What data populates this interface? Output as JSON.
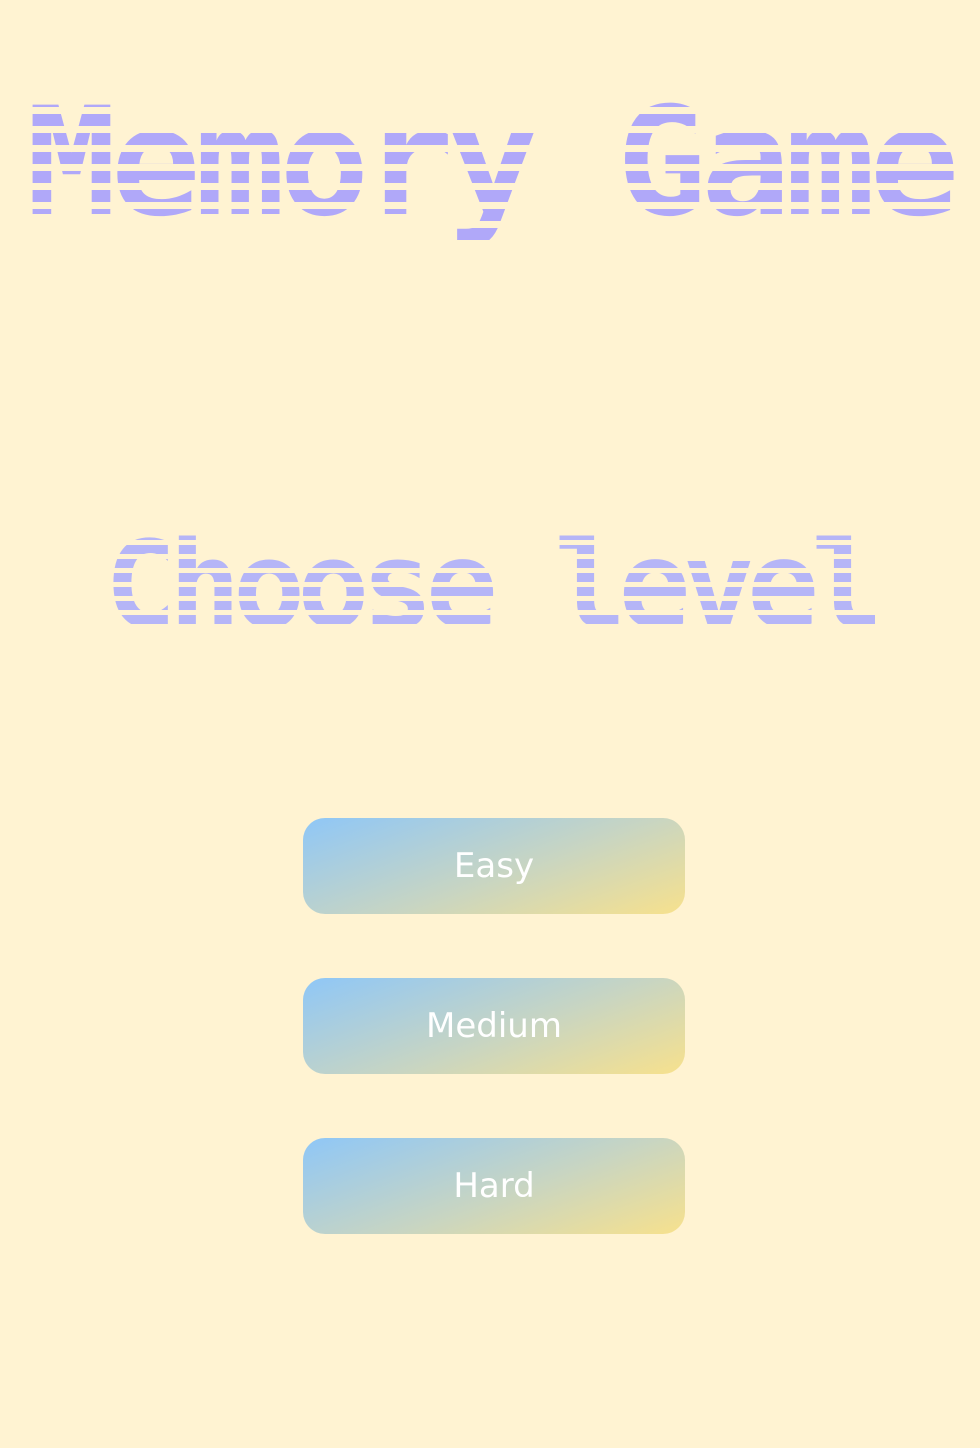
{
  "title": "Memory Game",
  "subtitle": "Choose level",
  "levels": [
    {
      "label": "Easy"
    },
    {
      "label": "Medium"
    },
    {
      "label": "Hard"
    }
  ],
  "colors": {
    "background": "#FFF3D2",
    "title": "#B0A8F9",
    "subtitle": "#B5B5F7",
    "button_gradient_start": "#8FC7F7",
    "button_gradient_end": "#F7E18D",
    "button_text": "#FFFFFF"
  }
}
